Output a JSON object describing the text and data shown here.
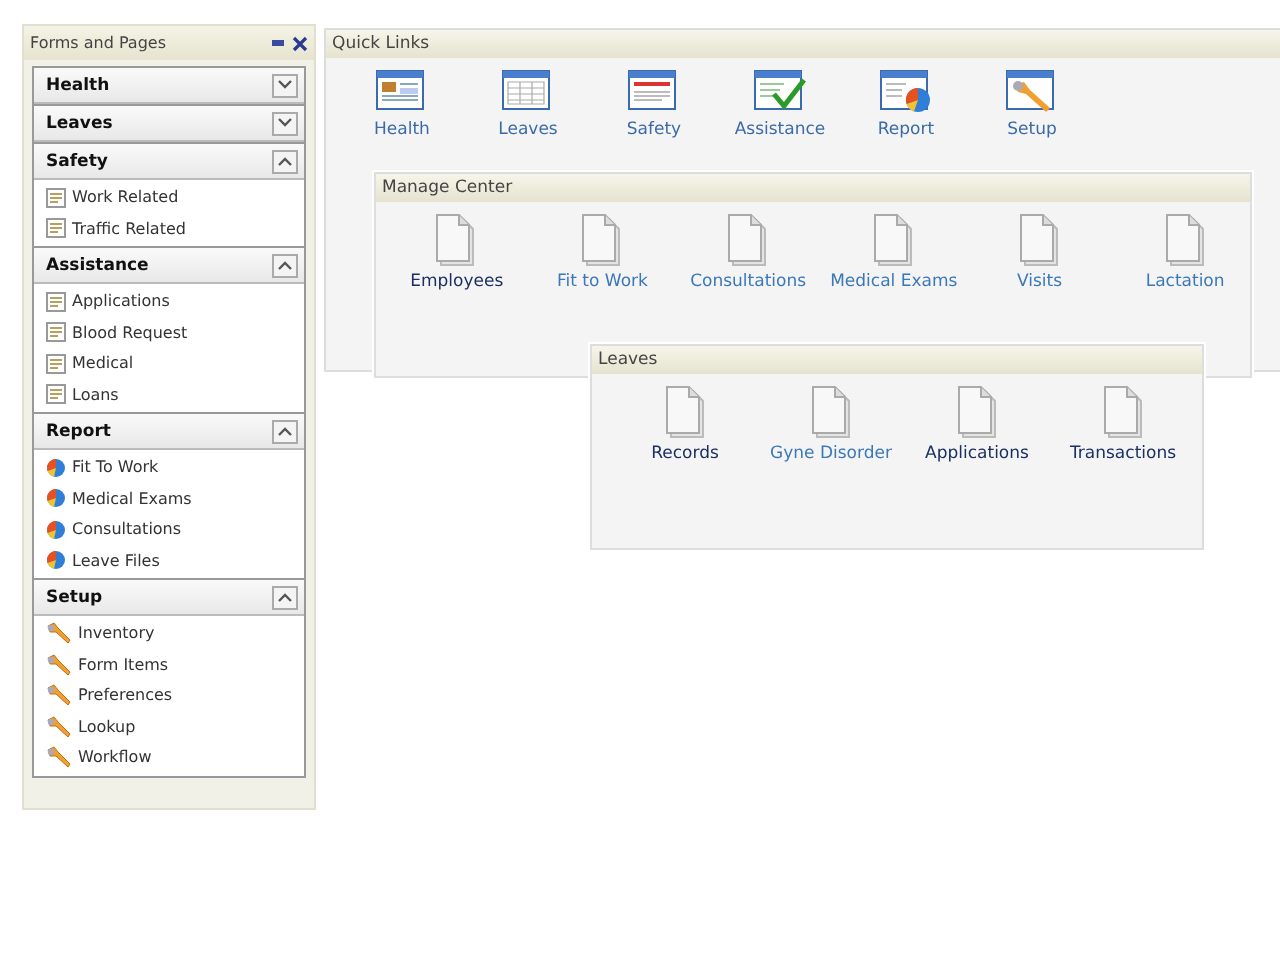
{
  "sidebar": {
    "title": "Forms and Pages",
    "sections": [
      {
        "title": "Health",
        "expanded": false
      },
      {
        "title": "Leaves",
        "expanded": false
      },
      {
        "title": "Safety",
        "expanded": true,
        "items": [
          {
            "label": "Work Related",
            "kind": "form"
          },
          {
            "label": "Traffic Related",
            "kind": "form"
          }
        ]
      },
      {
        "title": "Assistance",
        "expanded": true,
        "items": [
          {
            "label": "Applications",
            "kind": "form"
          },
          {
            "label": "Blood Request",
            "kind": "form"
          },
          {
            "label": "Medical",
            "kind": "form"
          },
          {
            "label": "Loans",
            "kind": "form"
          }
        ]
      },
      {
        "title": "Report",
        "expanded": true,
        "items": [
          {
            "label": "Fit To Work",
            "kind": "report"
          },
          {
            "label": "Medical Exams",
            "kind": "report"
          },
          {
            "label": "Consultations",
            "kind": "report"
          },
          {
            "label": "Leave Files",
            "kind": "report"
          }
        ]
      },
      {
        "title": "Setup",
        "expanded": true,
        "items": [
          {
            "label": "Inventory",
            "kind": "tool"
          },
          {
            "label": "Form Items",
            "kind": "tool"
          },
          {
            "label": "Preferences",
            "kind": "tool"
          },
          {
            "label": "Lookup",
            "kind": "tool"
          },
          {
            "label": "Workflow",
            "kind": "tool"
          }
        ]
      }
    ]
  },
  "quick_links": {
    "title": "Quick Links",
    "items": [
      {
        "label": "Health",
        "kind": "health"
      },
      {
        "label": "Leaves",
        "kind": "table"
      },
      {
        "label": "Safety",
        "kind": "safety"
      },
      {
        "label": "Assistance",
        "kind": "check"
      },
      {
        "label": "Report",
        "kind": "report"
      },
      {
        "label": "Setup",
        "kind": "tool"
      }
    ]
  },
  "manage_center": {
    "title": "Manage Center",
    "items": [
      {
        "label": "Employees",
        "visited": true
      },
      {
        "label": "Fit to Work",
        "visited": false
      },
      {
        "label": "Consultations",
        "visited": false
      },
      {
        "label": "Medical Exams",
        "visited": false
      },
      {
        "label": "Visits",
        "visited": false
      },
      {
        "label": "Lactation",
        "visited": false
      }
    ]
  },
  "leaves": {
    "title": "Leaves",
    "items": [
      {
        "label": "Records",
        "visited": true
      },
      {
        "label": "Gyne Disorder",
        "visited": false
      },
      {
        "label": "Applications",
        "visited": true
      },
      {
        "label": "Transactions",
        "visited": true
      }
    ]
  }
}
